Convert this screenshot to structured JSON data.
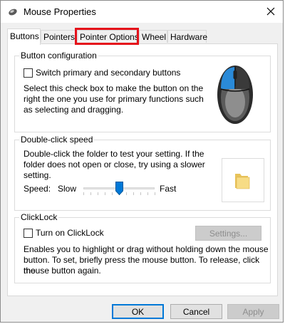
{
  "window": {
    "title": "Mouse Properties",
    "close_label": "×"
  },
  "tabs": [
    {
      "label": "Buttons",
      "active": true
    },
    {
      "label": "Pointers"
    },
    {
      "label": "Pointer Options",
      "highlighted": true
    },
    {
      "label": "Wheel"
    },
    {
      "label": "Hardware"
    }
  ],
  "button_configuration": {
    "legend": "Button configuration",
    "checkbox_label": "Switch primary and secondary buttons",
    "checked": false,
    "description_lines": [
      "Select this check box to make the button on the",
      "right the one you use for primary functions such",
      "as selecting and dragging."
    ]
  },
  "double_click": {
    "legend": "Double-click speed",
    "description_lines": [
      "Double-click the folder to test your setting. If the",
      "folder does not open or close, try using a slower",
      "setting."
    ],
    "speed_label": "Speed:",
    "slow_label": "Slow",
    "fast_label": "Fast",
    "speed_value": 0.5
  },
  "clicklock": {
    "legend": "ClickLock",
    "checkbox_label": "Turn on ClickLock",
    "checked": false,
    "settings_button": "Settings...",
    "description_lines": [
      "Enables you to highlight or drag without holding down the mouse",
      "button. To set, briefly press the mouse button. To release, click the",
      "mouse button again."
    ]
  },
  "footer": {
    "ok": "OK",
    "cancel": "Cancel",
    "apply": "Apply"
  },
  "colors": {
    "highlight": "#e5121b",
    "accent": "#0078d7"
  }
}
